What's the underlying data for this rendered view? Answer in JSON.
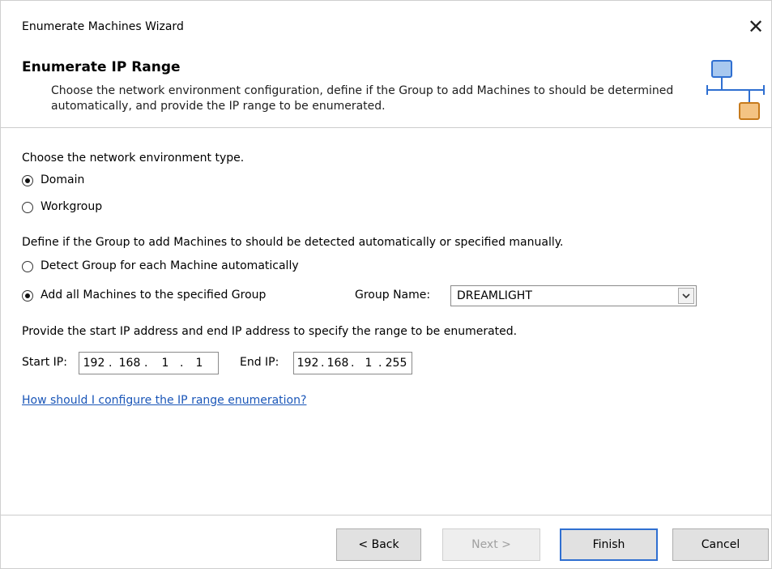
{
  "window": {
    "title": "Enumerate Machines Wizard",
    "close_glyph": "✕"
  },
  "banner": {
    "title": "Enumerate IP Range",
    "description": "Choose the network environment configuration, define if the Group to add Machines to should be determined automatically, and provide the IP range to be enumerated.",
    "icon": "network-range-icon"
  },
  "network_type": {
    "prompt": "Choose the network environment type.",
    "options": [
      {
        "label": "Domain",
        "checked": true
      },
      {
        "label": "Workgroup",
        "checked": false
      }
    ]
  },
  "group_mode": {
    "prompt": "Define if the Group to add Machines to should be detected automatically or specified manually.",
    "options": [
      {
        "label": "Detect Group for each Machine automatically",
        "checked": false
      },
      {
        "label": "Add all Machines to the specified Group",
        "checked": true
      }
    ],
    "group_name_label": "Group Name:",
    "group_name_value": "DREAMLIGHT"
  },
  "ip_range": {
    "prompt": "Provide the start IP address and end IP address to specify the range to be enumerated.",
    "start_label": "Start IP:",
    "start": [
      "192",
      "168",
      "1",
      "1"
    ],
    "end_label": "End IP:",
    "end": [
      "192",
      "168",
      "1",
      "255"
    ]
  },
  "help_link": "How should I configure the IP range enumeration?",
  "buttons": {
    "back": "< Back",
    "next": "Next >",
    "finish": "Finish",
    "cancel": "Cancel"
  },
  "colors": {
    "link": "#1a56b8",
    "icon_blue": "#a8c8ef",
    "icon_orange": "#f4c383",
    "icon_line": "#2f6fd1",
    "default_button_border": "#2f6fd1"
  }
}
